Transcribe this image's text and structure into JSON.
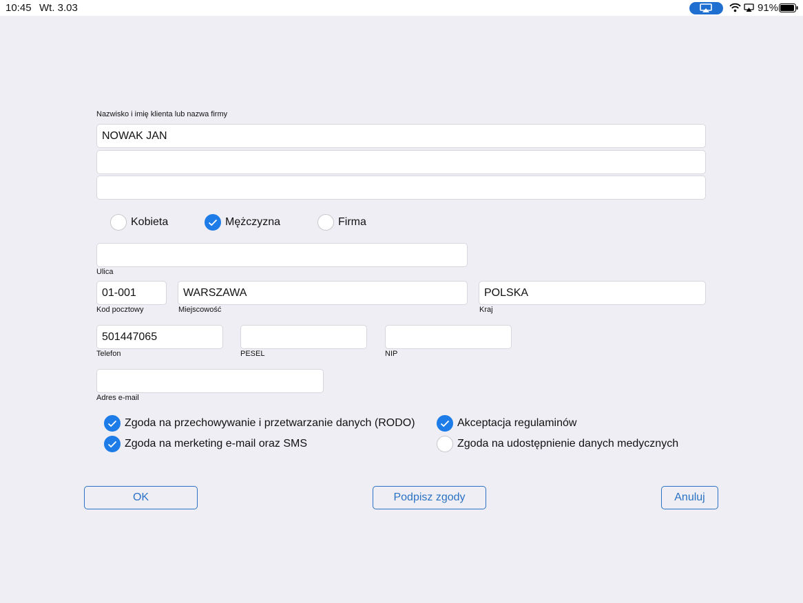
{
  "status_bar": {
    "time": "10:45",
    "date": "Wt. 3.03",
    "battery": "91%"
  },
  "form": {
    "name": {
      "label": "Nazwisko i imię klienta lub nazwa firmy",
      "line1": "NOWAK JAN",
      "line2": "",
      "line3": ""
    },
    "gender": [
      {
        "label": "Kobieta",
        "selected": false
      },
      {
        "label": "Mężczyzna",
        "selected": true
      },
      {
        "label": "Firma",
        "selected": false
      }
    ],
    "street": {
      "label": "Ulica",
      "value": ""
    },
    "postal_code": {
      "label": "Kod pocztowy",
      "value": "01-001"
    },
    "city": {
      "label": "Miejscowość",
      "value": "WARSZAWA"
    },
    "country": {
      "label": "Kraj",
      "value": "POLSKA"
    },
    "phone": {
      "label": "Telefon",
      "value": "501447065"
    },
    "pesel": {
      "label": "PESEL",
      "value": ""
    },
    "nip": {
      "label": "NIP",
      "value": ""
    },
    "email": {
      "label": "Adres e-mail",
      "value": ""
    },
    "consents": [
      {
        "label": "Zgoda na przechowywanie i przetwarzanie danych (RODO)",
        "checked": true
      },
      {
        "label": "Akceptacja regulaminów",
        "checked": true
      },
      {
        "label": "Zgoda na merketing e-mail oraz SMS",
        "checked": true
      },
      {
        "label": "Zgoda na udostępnienie danych medycznych",
        "checked": false
      }
    ]
  },
  "buttons": {
    "ok": "OK",
    "sign": "Podpisz zgody",
    "cancel": "Anuluj"
  },
  "colors": {
    "accent": "#1e7ce8",
    "button_text": "#2a72c4",
    "background": "#efeef4"
  }
}
